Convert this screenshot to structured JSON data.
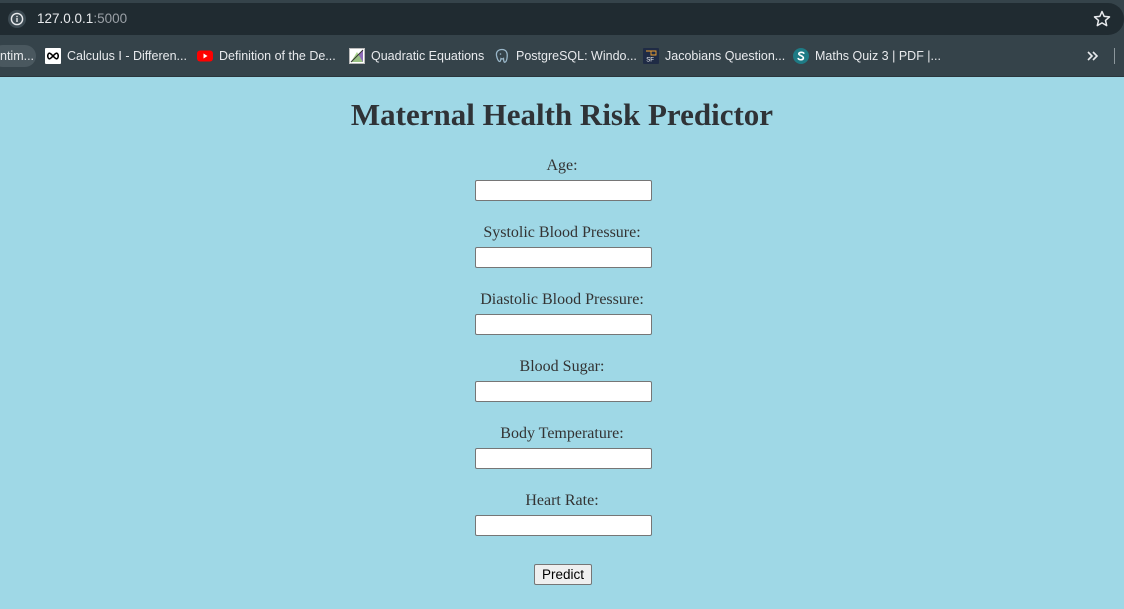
{
  "browser": {
    "url_host": "127.0.0.1",
    "url_port": ":5000",
    "bookmarks": [
      {
        "label": "ntim...",
        "icon": "generic-bookmark-icon"
      },
      {
        "label": "Calculus I - Differen...",
        "icon": "infinity-icon"
      },
      {
        "label": "Definition of the De...",
        "icon": "youtube-icon"
      },
      {
        "label": "Quadratic Equations",
        "icon": "geometry-icon"
      },
      {
        "label": "PostgreSQL: Windo...",
        "icon": "postgresql-elephant-icon"
      },
      {
        "label": "Jacobians Question...",
        "icon": "sf-icon"
      },
      {
        "label": "Maths Quiz 3 | PDF |...",
        "icon": "scribd-icon"
      }
    ],
    "colors": {
      "toolbar": "#35434a",
      "omnibox": "#202b31",
      "page_background": "#9fd8e6"
    }
  },
  "page": {
    "title": "Maternal Health Risk Predictor",
    "fields": [
      {
        "label": "Age:",
        "value": ""
      },
      {
        "label": "Systolic Blood Pressure:",
        "value": ""
      },
      {
        "label": "Diastolic Blood Pressure:",
        "value": ""
      },
      {
        "label": "Blood Sugar:",
        "value": ""
      },
      {
        "label": "Body Temperature:",
        "value": ""
      },
      {
        "label": "Heart Rate:",
        "value": ""
      }
    ],
    "submit_label": "Predict"
  }
}
